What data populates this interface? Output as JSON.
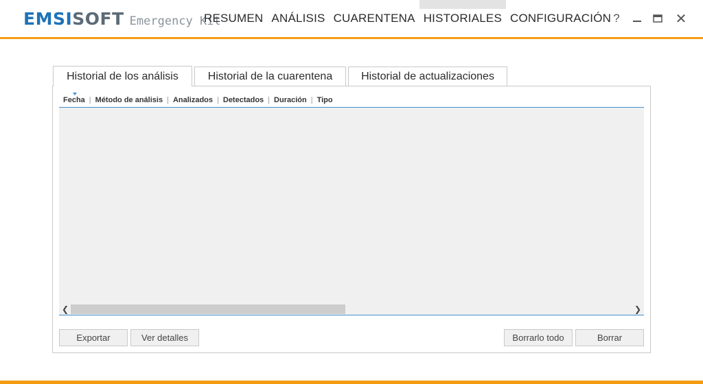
{
  "app": {
    "logo_brand_part1": "EMSI",
    "logo_brand_part2": "SOFT",
    "logo_product": "Emergency Kit"
  },
  "nav": {
    "items": [
      {
        "label": "RESUMEN"
      },
      {
        "label": "ANÁLISIS"
      },
      {
        "label": "CUARENTENA"
      },
      {
        "label": "HISTORIALES",
        "active": true
      },
      {
        "label": "CONFIGURACIÓN"
      }
    ]
  },
  "window_controls": {
    "help": "?",
    "close": "✕"
  },
  "tabs": [
    {
      "label": "Historial de los análisis",
      "active": true
    },
    {
      "label": "Historial de la cuarentena"
    },
    {
      "label": "Historial de actualizaciones"
    }
  ],
  "table": {
    "columns": [
      "Fecha",
      "Método de análisis",
      "Analizados",
      "Detectados",
      "Duración",
      "Tipo"
    ],
    "sort_column": "Fecha",
    "rows": []
  },
  "buttons": {
    "export": "Exportar",
    "details": "Ver detalles",
    "delete_all": "Borrarlo todo",
    "delete": "Borrar"
  },
  "colors": {
    "accent_orange": "#f39c12",
    "brand_blue": "#1f73b7",
    "brand_gray": "#5c6b77",
    "header_rule_blue": "#3e8ed0"
  }
}
